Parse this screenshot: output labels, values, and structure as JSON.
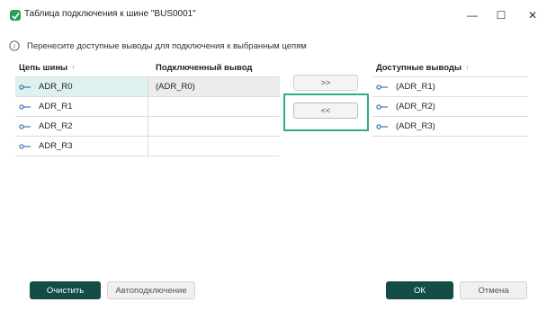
{
  "window": {
    "title": "Таблица подключения к шине \"BUS0001\"",
    "controls": {
      "minimize": "—",
      "maximize": "☐",
      "close": "✕"
    }
  },
  "info": {
    "text": "Перенесите доступные выводы для подключения к выбранным цепям"
  },
  "left_table": {
    "headers": {
      "net": "Цепь шины",
      "connected": "Подключенный вывод"
    },
    "sort_indicator": "↑",
    "rows": [
      {
        "net": "ADR_R0",
        "connected": "(ADR_R0)",
        "selected": true
      },
      {
        "net": "ADR_R1",
        "connected": "",
        "selected": false
      },
      {
        "net": "ADR_R2",
        "connected": "",
        "selected": false
      },
      {
        "net": "ADR_R3",
        "connected": "",
        "selected": false
      }
    ]
  },
  "transfer": {
    "add_label": ">>",
    "remove_label": "<<"
  },
  "right_table": {
    "header": "Доступные выводы",
    "sort_indicator": "↑",
    "rows": [
      {
        "pin": "(ADR_R1)"
      },
      {
        "pin": "(ADR_R2)"
      },
      {
        "pin": "(ADR_R3)"
      }
    ]
  },
  "footer": {
    "clear_label": "Очистить",
    "autoconnect_label": "Автоподключение",
    "ok_label": "ОК",
    "cancel_label": "Отмена"
  },
  "colors": {
    "accent_dark": "#134d45",
    "selection": "#dff0f0",
    "focus": "#2eae7c",
    "pin_icon": "#2c6cb0"
  }
}
